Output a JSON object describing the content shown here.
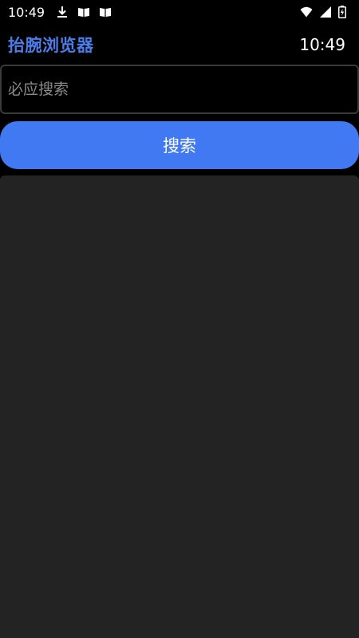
{
  "status_bar": {
    "time": "10:49",
    "left_icons": [
      "download-icon",
      "book-icon",
      "book-icon"
    ],
    "right_icons": [
      "wifi-icon",
      "signal-icon",
      "battery-charging-icon"
    ]
  },
  "header": {
    "title": "抬腕浏览器",
    "clock": "10:49"
  },
  "search": {
    "placeholder": "必应搜索",
    "value": "",
    "button_label": "搜索"
  },
  "colors": {
    "background": "#000000",
    "accent": "#4179f2",
    "title": "#4a7dea",
    "panel": "#232323"
  }
}
